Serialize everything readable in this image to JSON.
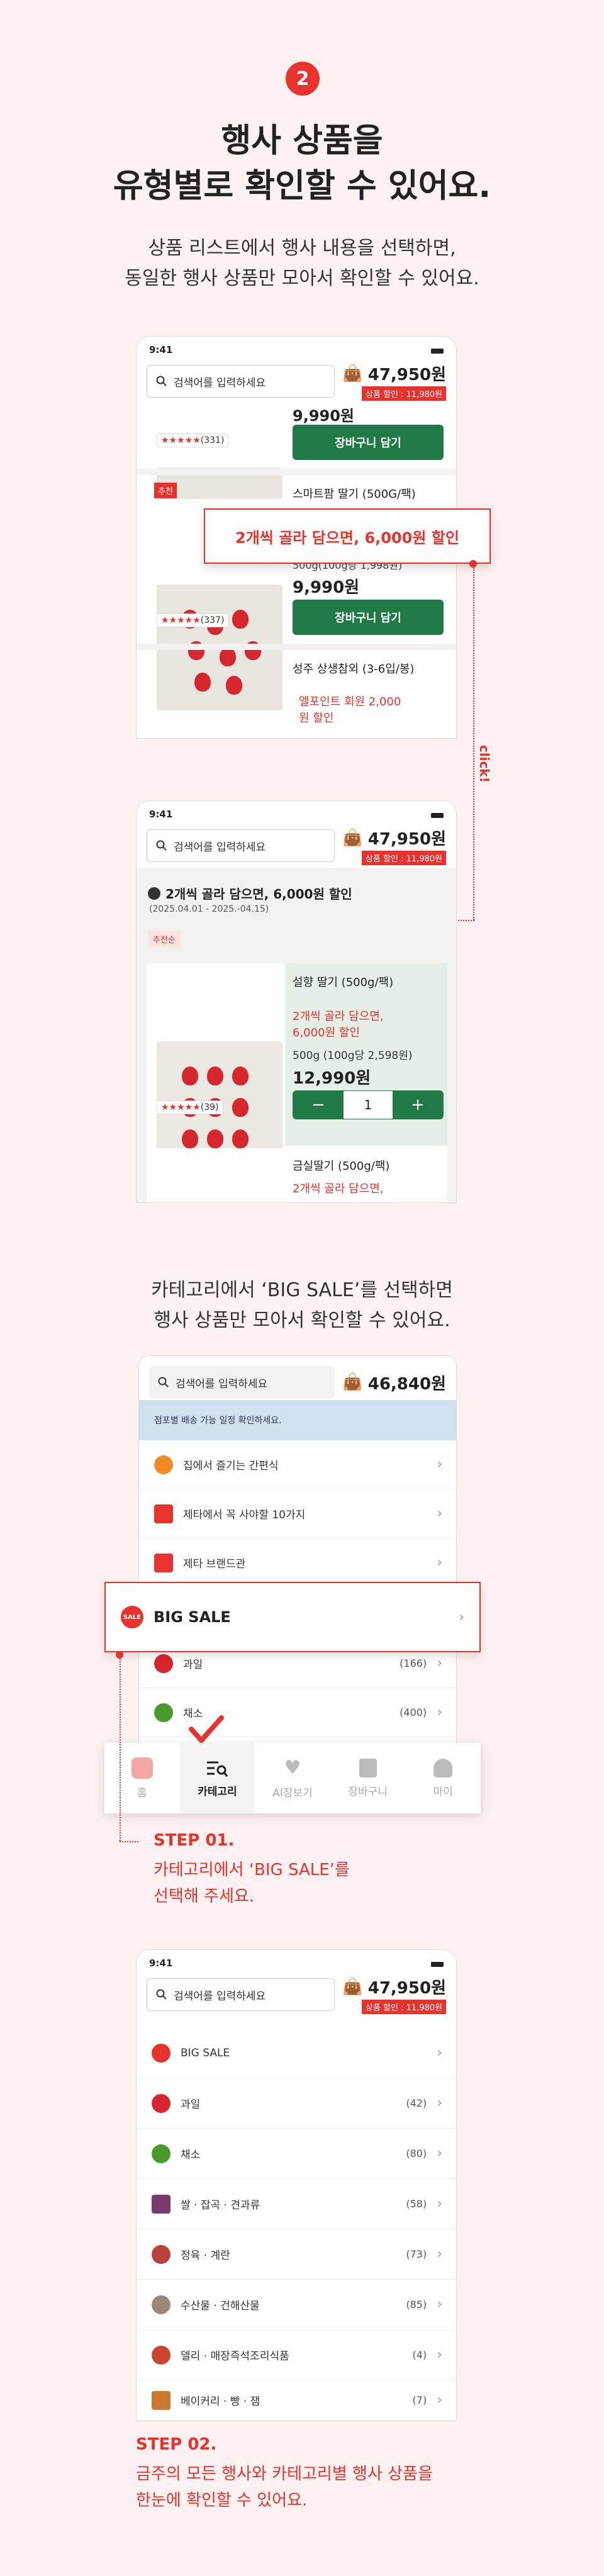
{
  "section_number": "2",
  "headline": [
    "행사 상품을",
    "유형별로 확인할 수 있어요."
  ],
  "subtext": [
    "상품 리스트에서 행사 내용을 선택하면,",
    "동일한 행사 상품만 모아서 확인할 수 있어요."
  ],
  "status_time": "9:41",
  "search_placeholder": "검색어를 입력하세요",
  "cart_amount": "47,950원",
  "cart_sale": "상품 할인 : 11,980원",
  "phone1": {
    "prev_price": "9,990원",
    "prev_reviews": "(331)",
    "cart_button": "장바구니 담기",
    "badge": "추천",
    "product_name": "스마트팜 딸기 (500G/팩)",
    "unit_price": "500g(100g당 1,998원)",
    "price": "9,990원",
    "reviews": "(337)",
    "third_name": "성주 상생참외 (3-6입/봉)",
    "third_promo": [
      "엘포인트 회원 2,000",
      "원 할인"
    ]
  },
  "callout": "2개씩 골라 담으면, 6,000원 할인",
  "click_label": "click!",
  "phone2": {
    "event_title": "2개씩 골라 담으면, 6,000원 할인",
    "event_period": "(2025.04.01 - 2025.-04.15)",
    "sort_chip": "추천순",
    "product_name": "설향 딸기 (500g/팩)",
    "promo": [
      "2개씩 골라 담으면,",
      "6,000원 할인"
    ],
    "unit_price": "500g (100g당 2,598원)",
    "price": "12,990원",
    "qty": "1",
    "minus": "−",
    "plus": "+",
    "reviews": "(39)",
    "next_name": "금실딸기 (500g/팩)",
    "next_promo": "2개씩 골라 담으면,"
  },
  "section2_text": [
    "카테고리에서 ‘BIG SALE’를 선택하면",
    "행사 상품만 모아서 확인할 수 있어요."
  ],
  "phone3": {
    "cart_amount": "46,840원",
    "banner": "점포별 배송 가능 일정 확인하세요.",
    "rows": [
      {
        "label": "집에서 즐기는 간편식",
        "count": ""
      },
      {
        "label": "제타에서 꼭 사야할 10가지",
        "count": ""
      },
      {
        "label": "제타 브랜드관",
        "count": ""
      }
    ],
    "big_sale": "BIG SALE",
    "rows2": [
      {
        "label": "과일",
        "count": "(166)"
      },
      {
        "label": "채소",
        "count": "(400)"
      }
    ],
    "tabs": [
      "홈",
      "카테고리",
      "AI장보기",
      "장바구니",
      "마이"
    ]
  },
  "step1_title": "STEP 01.",
  "step1_desc": [
    "카테고리에서 ‘BIG SALE’를",
    "선택해 주세요."
  ],
  "phone4": {
    "rows": [
      {
        "label": "BIG SALE",
        "count": ""
      },
      {
        "label": "과일",
        "count": "(42)"
      },
      {
        "label": "채소",
        "count": "(80)"
      },
      {
        "label": "쌀 · 잡곡 · 견과류",
        "count": "(58)"
      },
      {
        "label": "정육 · 계란",
        "count": "(73)"
      },
      {
        "label": "수산물 · 건해산물",
        "count": "(85)"
      },
      {
        "label": "델리 · 매장즉석조리식품",
        "count": "(4)"
      },
      {
        "label": "베이커리 · 빵 · 잼",
        "count": "(7)"
      }
    ]
  },
  "step2_title": "STEP 02.",
  "step2_desc": [
    "금주의 모든 행사와 카테고리별 행사 상품을",
    "한눈에 확인할 수 있어요."
  ],
  "colors": {
    "accent": "#e8322d",
    "green": "#1f7a45",
    "background": "#fdf2f1"
  }
}
